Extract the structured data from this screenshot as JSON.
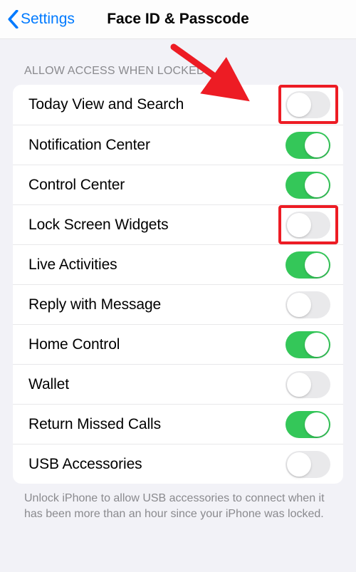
{
  "nav": {
    "back_label": "Settings",
    "title": "Face ID & Passcode"
  },
  "section": {
    "header": "ALLOW ACCESS WHEN LOCKED:",
    "items": [
      {
        "label": "Today View and Search",
        "on": false,
        "highlighted": true
      },
      {
        "label": "Notification Center",
        "on": true,
        "highlighted": false
      },
      {
        "label": "Control Center",
        "on": true,
        "highlighted": false
      },
      {
        "label": "Lock Screen Widgets",
        "on": false,
        "highlighted": true
      },
      {
        "label": "Live Activities",
        "on": true,
        "highlighted": false
      },
      {
        "label": "Reply with Message",
        "on": false,
        "highlighted": false
      },
      {
        "label": "Home Control",
        "on": true,
        "highlighted": false
      },
      {
        "label": "Wallet",
        "on": false,
        "highlighted": false
      },
      {
        "label": "Return Missed Calls",
        "on": true,
        "highlighted": false
      },
      {
        "label": "USB Accessories",
        "on": false,
        "highlighted": false
      }
    ],
    "footer": "Unlock iPhone to allow USB accessories to connect when it has been more than an hour since your iPhone was locked."
  },
  "annotation": {
    "arrow_color": "#ed1c24",
    "highlight_color": "#ed1c24"
  }
}
